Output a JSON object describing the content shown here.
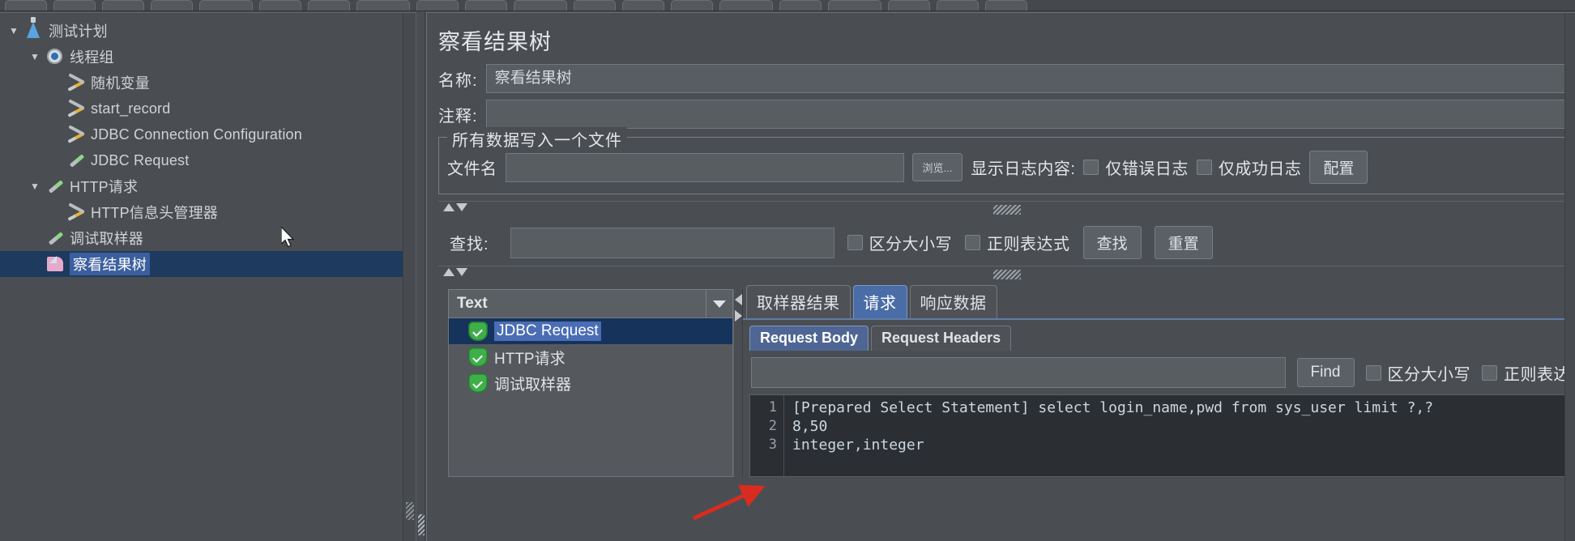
{
  "toolbar": {
    "button_count": 20
  },
  "tree": {
    "nodes": [
      {
        "label": "测试计划",
        "icon": "flask-icon",
        "indent": 0,
        "toggle": "▼",
        "selected": false
      },
      {
        "label": "线程组",
        "icon": "gear-icon",
        "indent": 1,
        "toggle": "▼",
        "selected": false
      },
      {
        "label": "随机变量",
        "icon": "wrench-icon",
        "indent": 2,
        "toggle": "",
        "selected": false
      },
      {
        "label": "start_record",
        "icon": "wrench-icon",
        "indent": 2,
        "toggle": "",
        "selected": false
      },
      {
        "label": "JDBC Connection Configuration",
        "icon": "wrench-icon",
        "indent": 2,
        "toggle": "",
        "selected": false
      },
      {
        "label": "JDBC Request",
        "icon": "pipette-icon",
        "indent": 2,
        "toggle": "",
        "selected": false
      },
      {
        "label": "HTTP请求",
        "icon": "pipette-icon",
        "indent": 1,
        "toggle": "▼",
        "selected": false
      },
      {
        "label": "HTTP信息头管理器",
        "icon": "wrench-icon",
        "indent": 2,
        "toggle": "",
        "selected": false
      },
      {
        "label": "调试取样器",
        "icon": "pipette-icon",
        "indent": 1,
        "toggle": "",
        "selected": false
      },
      {
        "label": "察看结果树",
        "icon": "tree-icon",
        "indent": 1,
        "toggle": "",
        "selected": true
      }
    ]
  },
  "panel": {
    "title": "察看结果树",
    "name_label": "名称:",
    "name_value": "察看结果树",
    "comment_label": "注释:",
    "comment_value": ""
  },
  "file_group": {
    "title": "所有数据写入一个文件",
    "filename_label": "文件名",
    "filename_value": "",
    "browse_button": "浏览...",
    "log_display_label": "显示日志内容:",
    "errors_only_checkbox": "仅错误日志",
    "success_only_checkbox": "仅成功日志",
    "configure_button": "配置"
  },
  "search": {
    "label": "查找:",
    "value": "",
    "case_sensitive_checkbox": "区分大小写",
    "regex_checkbox": "正则表达式",
    "find_button": "查找",
    "reset_button": "重置"
  },
  "results": {
    "view_selector_value": "Text",
    "items": [
      {
        "label": "JDBC Request",
        "status": "success",
        "selected": true
      },
      {
        "label": "HTTP请求",
        "status": "success",
        "selected": false
      },
      {
        "label": "调试取样器",
        "status": "success",
        "selected": false
      }
    ]
  },
  "detail": {
    "tabs": [
      {
        "label": "取样器结果",
        "active": false
      },
      {
        "label": "请求",
        "active": true
      },
      {
        "label": "响应数据",
        "active": false
      }
    ],
    "subtabs": [
      {
        "label": "Request Body",
        "active": true
      },
      {
        "label": "Request Headers",
        "active": false
      }
    ],
    "find_button": "Find",
    "find_value": "",
    "case_sensitive_checkbox": "区分大小写",
    "regex_checkbox": "正则表达",
    "code": {
      "line_numbers": [
        "1",
        "2",
        "3"
      ],
      "lines": [
        "[Prepared Select Statement] select login_name,pwd from sys_user limit ?,?",
        "8,50",
        "integer,integer"
      ]
    }
  },
  "colors": {
    "background": "#4a4e52",
    "selection": "#1e3a5f",
    "tab_active": "#4a6da8",
    "success_green": "#3fae4b",
    "annotation_red": "#d92b1f",
    "code_background": "#2b2f33"
  }
}
